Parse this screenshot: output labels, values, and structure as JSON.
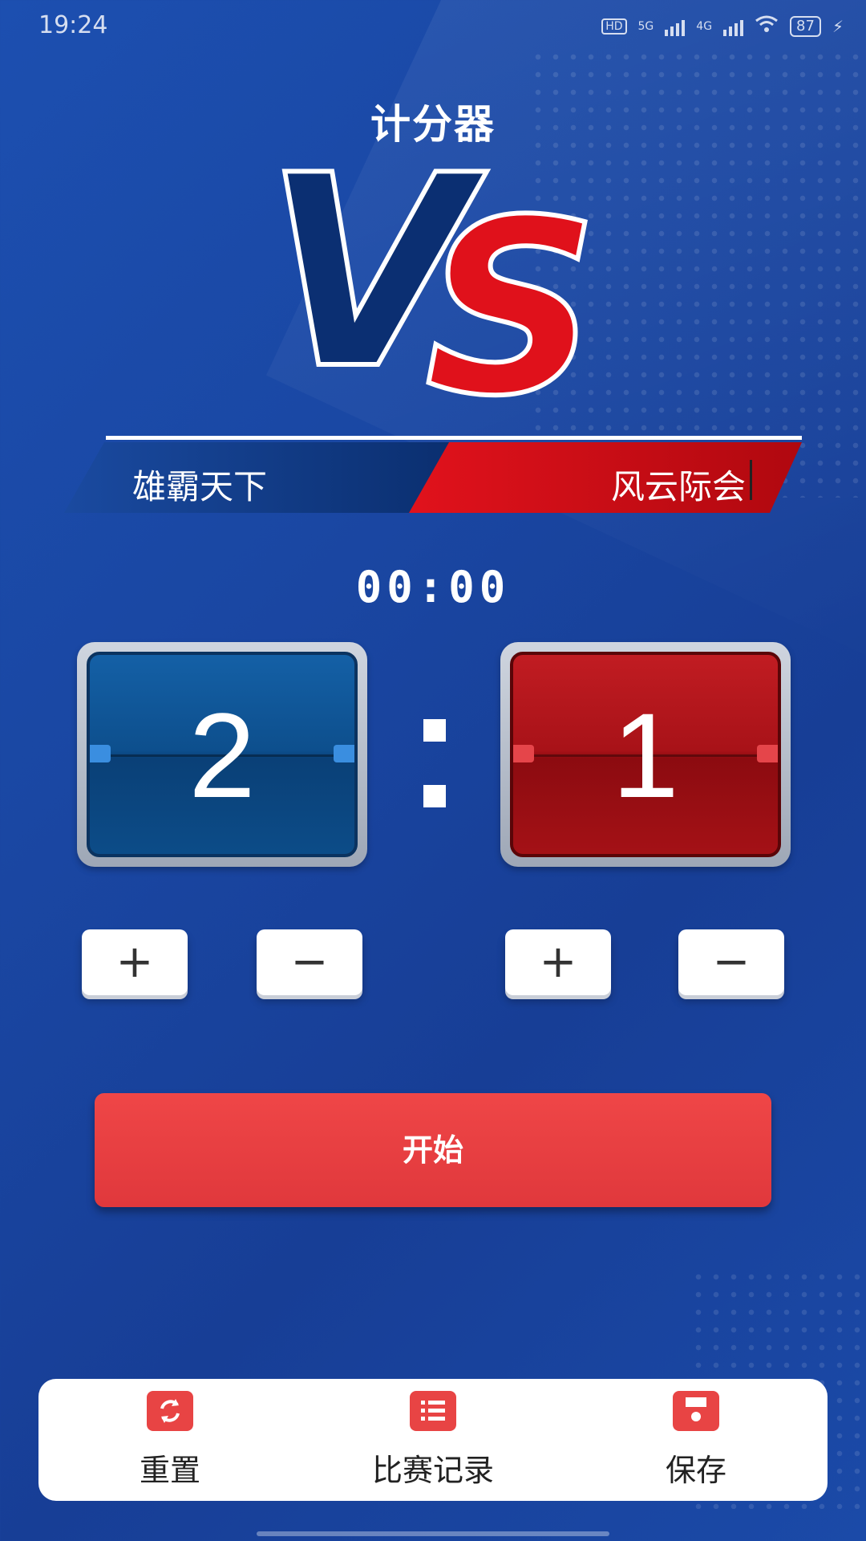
{
  "status_bar": {
    "time": "19:24",
    "signal_5g": "5G",
    "signal_4g": "4G",
    "battery": "87"
  },
  "title": "计分器",
  "vs": {
    "v": "V",
    "s": "S"
  },
  "teams": {
    "left": "雄霸天下",
    "right": "风云际会"
  },
  "timer": "00:00",
  "scores": {
    "left": "2",
    "right": "1"
  },
  "controls": {
    "plus": "+",
    "minus": "−"
  },
  "start_label": "开始",
  "bottom_nav": [
    {
      "label": "重置",
      "icon": "refresh-icon"
    },
    {
      "label": "比赛记录",
      "icon": "list-icon"
    },
    {
      "label": "保存",
      "icon": "save-icon"
    }
  ],
  "colors": {
    "accent_red": "#e84444",
    "team_blue": "#0d4f8d",
    "team_red": "#a81218"
  }
}
